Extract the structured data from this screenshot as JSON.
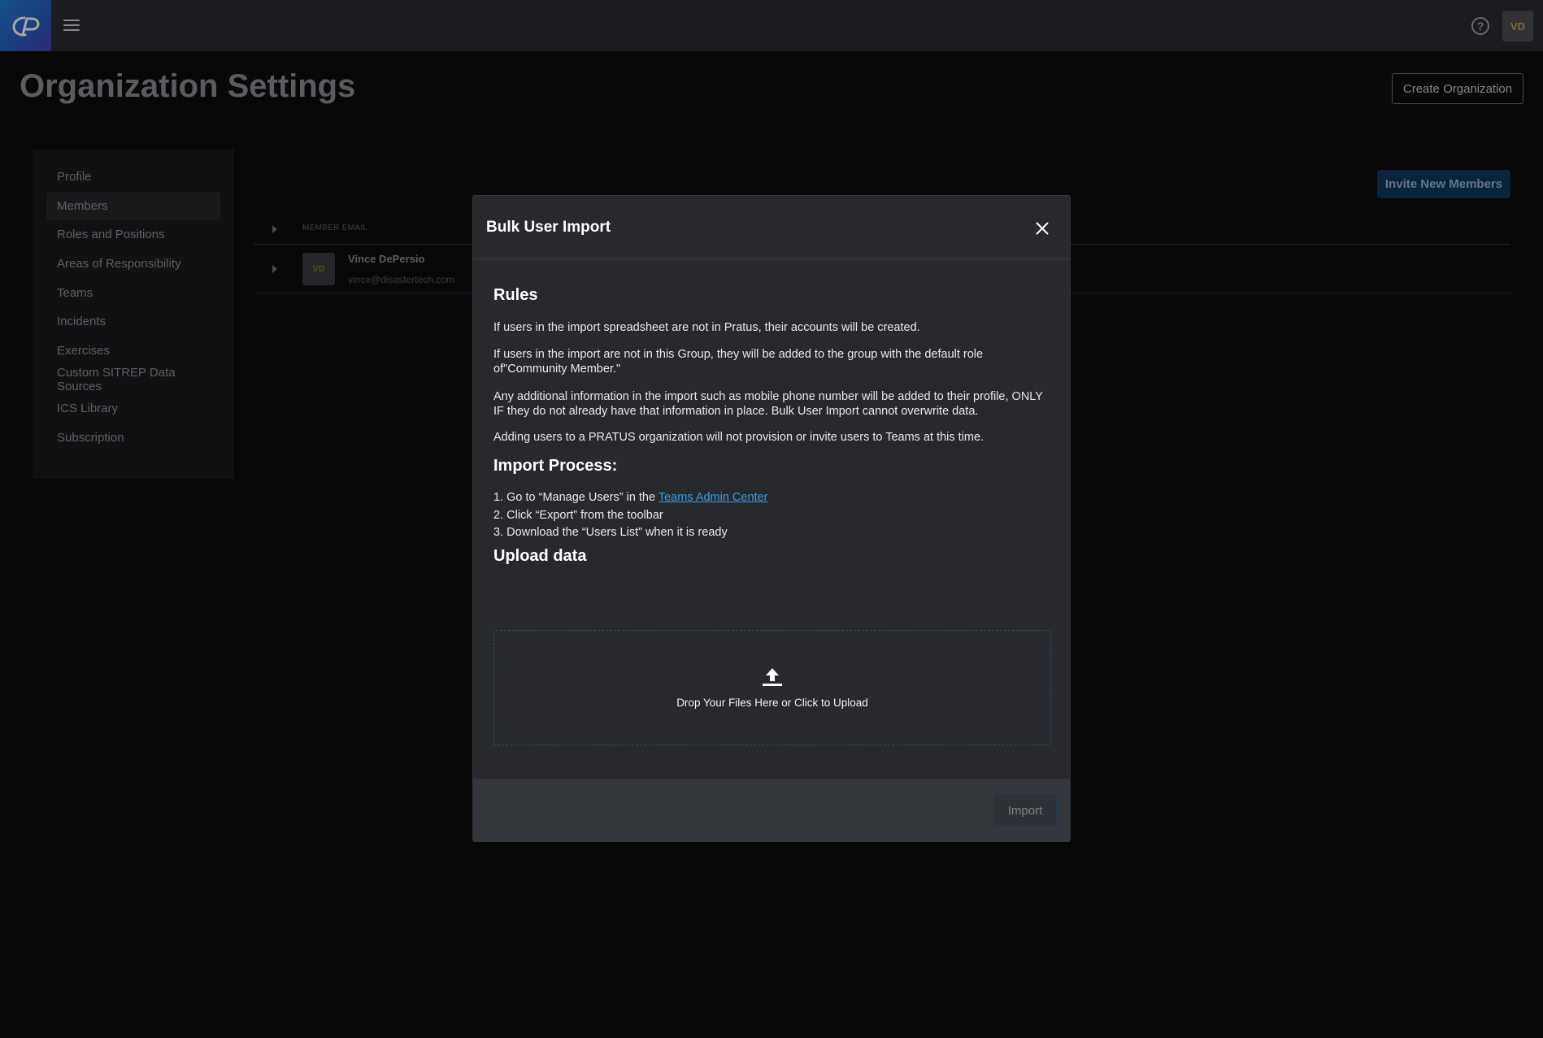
{
  "topbar": {
    "logo_icon": "pratus-logo-icon",
    "menu_icon": "hamburger-menu-icon",
    "help_icon": "help-circle-icon",
    "help_glyph": "?",
    "user_initials": "VD"
  },
  "page": {
    "title": "Organization Settings",
    "create_org_label": "Create Organization"
  },
  "sidebar": {
    "items": [
      {
        "label": "Profile"
      },
      {
        "label": "Members",
        "active": true
      },
      {
        "label": "Roles and Positions"
      },
      {
        "label": "Areas of Responsibility"
      },
      {
        "label": "Teams"
      },
      {
        "label": "Incidents"
      },
      {
        "label": "Exercises"
      },
      {
        "label": "Custom SITREP Data Sources"
      },
      {
        "label": "ICS Library"
      },
      {
        "label": "Subscription"
      }
    ]
  },
  "members": {
    "invite_label": "Invite New Members",
    "column_email": "MEMBER EMAIL",
    "rows": [
      {
        "initials": "VD",
        "name": "Vince DePersio",
        "email": "vince@disastertech.com"
      }
    ]
  },
  "modal": {
    "title": "Bulk User Import",
    "close_icon": "close-x-icon",
    "rules_heading": "Rules",
    "rules": [
      "If users in the import spreadsheet are not in Pratus, their accounts will be created.",
      "If users in the import are not in this Group, they will be added to the group with the default role of\"Community Member.\"",
      "Any additional information in the import such as mobile phone number will be added to their profile, ONLY IF they do not already have that information in place. Bulk User Import cannot overwrite data.",
      "Adding users to a PRATUS organization will not provision or invite users to Teams at this time."
    ],
    "process_heading": "Import Process:",
    "steps": {
      "step1_prefix": "1. Go to “Manage Users” in the ",
      "step1_link": "Teams Admin Center",
      "step2": "2. Click “Export” from the toolbar",
      "step3": "3. Download the “Users List” when it is ready"
    },
    "upload_heading": "Upload data",
    "upload_icon": "upload-arrow-icon",
    "drop_label": "Drop Your Files Here or Click to Upload",
    "import_label": "Import"
  },
  "colors": {
    "accent_link": "#3d9bdf",
    "invite_button": "#0f3a5c",
    "avatar_text": "#c7a05a"
  }
}
